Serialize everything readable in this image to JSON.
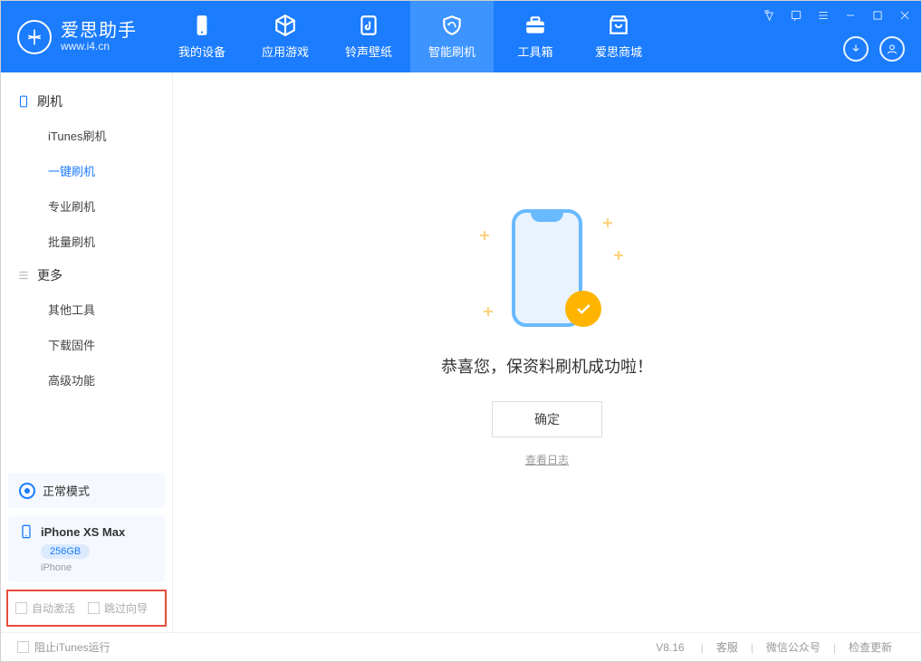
{
  "app": {
    "name": "爱思助手",
    "url": "www.i4.cn"
  },
  "nav": [
    {
      "label": "我的设备"
    },
    {
      "label": "应用游戏"
    },
    {
      "label": "铃声壁纸"
    },
    {
      "label": "智能刷机"
    },
    {
      "label": "工具箱"
    },
    {
      "label": "爱思商城"
    }
  ],
  "sidebar": {
    "sec1_title": "刷机",
    "sec1_items": [
      "iTunes刷机",
      "一键刷机",
      "专业刷机",
      "批量刷机"
    ],
    "sec2_title": "更多",
    "sec2_items": [
      "其他工具",
      "下载固件",
      "高级功能"
    ],
    "mode_label": "正常模式",
    "device": {
      "name": "iPhone XS Max",
      "capacity": "256GB",
      "type": "iPhone"
    },
    "chk_auto_activate": "自动激活",
    "chk_skip_guide": "跳过向导"
  },
  "content": {
    "success_msg": "恭喜您，保资料刷机成功啦！",
    "ok_btn": "确定",
    "view_log": "查看日志"
  },
  "footer": {
    "block_itunes": "阻止iTunes运行",
    "version": "V8.16",
    "link_service": "客服",
    "link_wechat": "微信公众号",
    "link_update": "检查更新"
  }
}
